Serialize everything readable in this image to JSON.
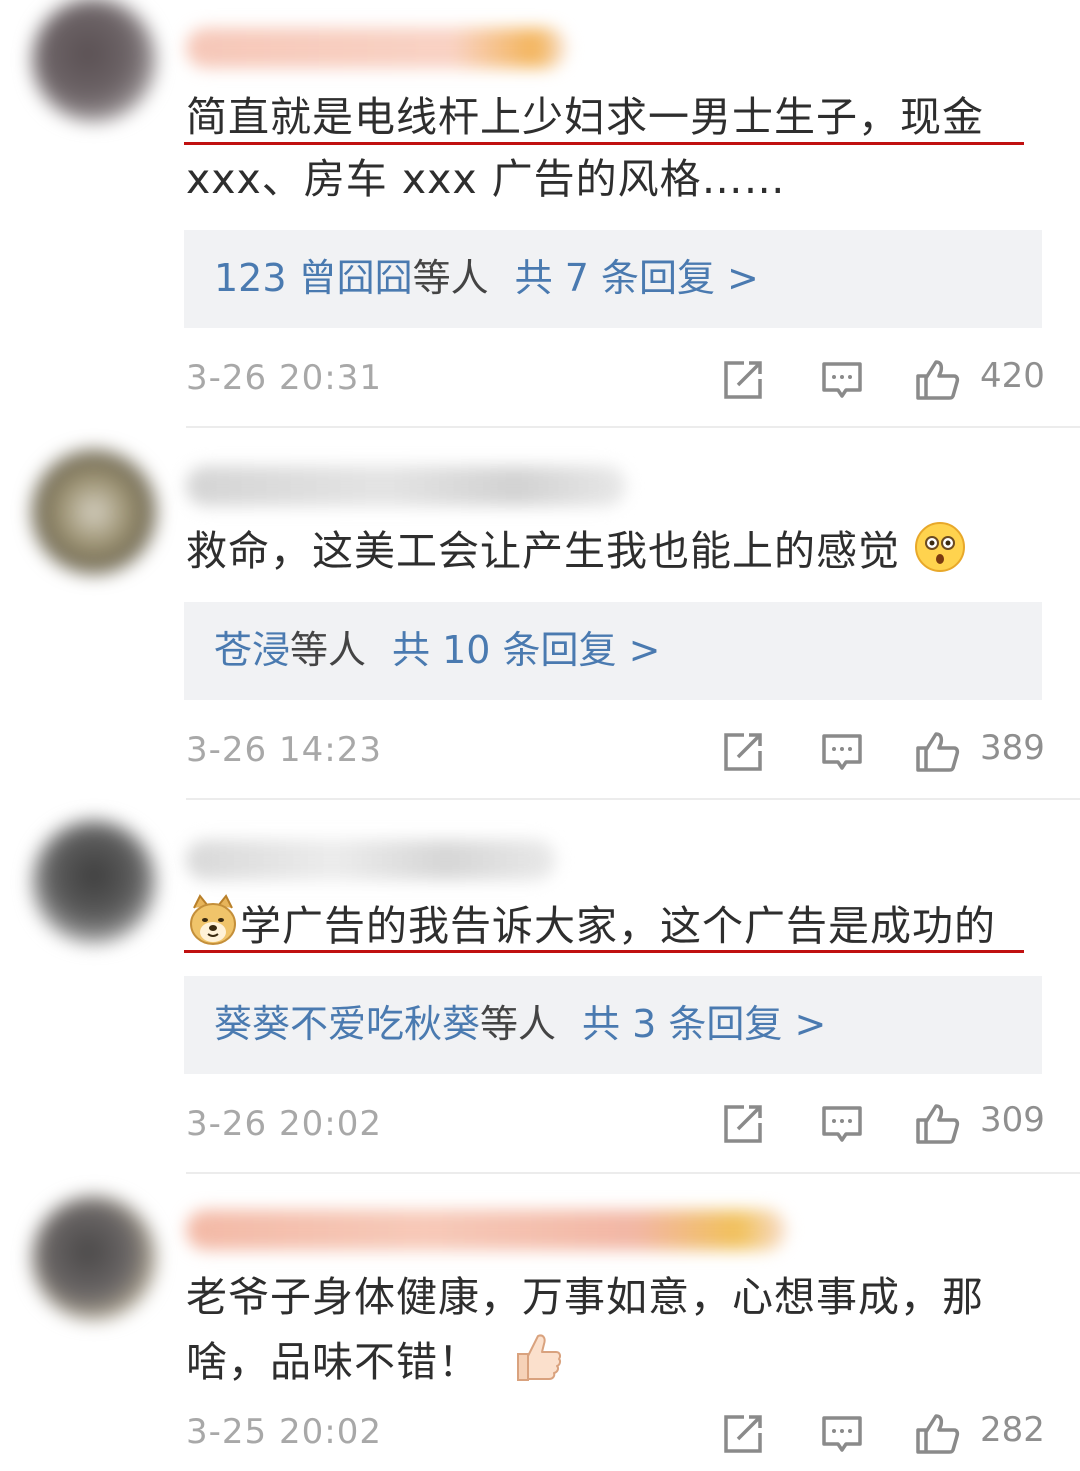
{
  "comments": [
    {
      "text_lines": [
        "简直就是电线杆上少妇求一男士生子，现金",
        "xxx、房车 xxx 广告的风格……"
      ],
      "reply": {
        "names": "123 曾囧囧",
        "others": "等人",
        "count": "共 7 条回复 >"
      },
      "time": "3-26 20:31",
      "likes": "420"
    },
    {
      "text_lines": [
        "救命，这美工会让产生我也能上的感觉"
      ],
      "emoji_after": "astonished-face-emoji",
      "reply": {
        "names": "苍浸",
        "others": "等人",
        "count": "共 10 条回复 >"
      },
      "time": "3-26 14:23",
      "likes": "389"
    },
    {
      "text_lines": [
        "学广告的我告诉大家，这个广告是成功的"
      ],
      "emoji_before": "doge-emoji",
      "reply": {
        "names": "葵葵不爱吃秋葵",
        "others": "等人",
        "count": "共 3 条回复 >"
      },
      "time": "3-26 20:02",
      "likes": "309"
    },
    {
      "text_lines": [
        "老爷子身体健康，万事如意，心想事成，那",
        "啥，品味不错！"
      ],
      "emoji_after": "thumbs-up-emoji",
      "time": "3-25 20:02",
      "likes": "282"
    }
  ],
  "icons": {
    "share": "share-icon",
    "comment": "comment-icon",
    "like": "like-icon"
  },
  "colors": {
    "link": "#4a7ab0",
    "underline": "#c01010",
    "reply_bg": "#f1f2f4",
    "meta": "#a8a8a8"
  }
}
